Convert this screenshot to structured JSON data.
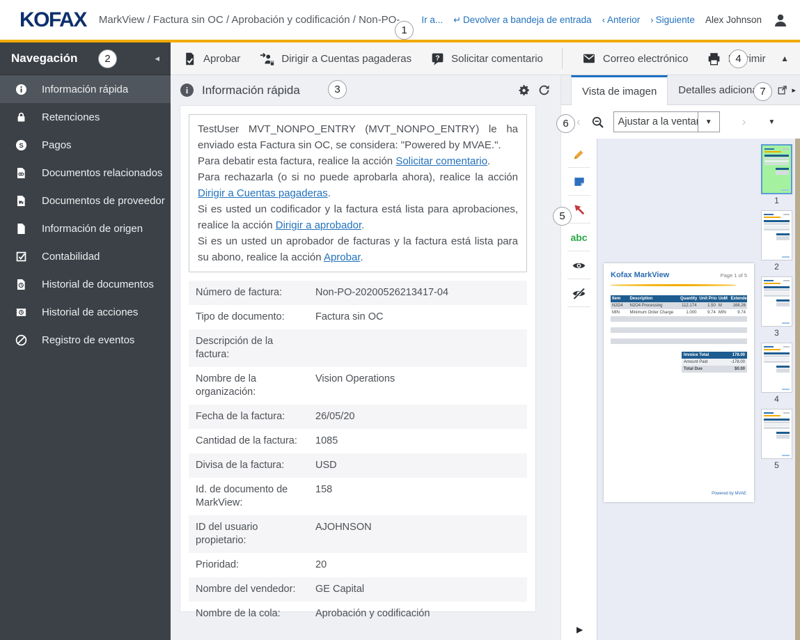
{
  "header": {
    "logo": "KOFAX",
    "breadcrumb": "MarkView / Factura sin OC / Aprobación y codificación / Non-PO-.",
    "go_to": "Ir a...",
    "return_link": "Devolver a bandeja de entrada",
    "prev": "Anterior",
    "next": "Siguiente",
    "user": "Alex Johnson"
  },
  "callouts": {
    "c1": "1",
    "c2": "2",
    "c3": "3",
    "c4": "4",
    "c5": "5",
    "c6": "6",
    "c7": "7"
  },
  "toolbar": {
    "approve": "Aprobar",
    "route_ap": "Dirigir a Cuentas pagaderas",
    "request_comment": "Solicitar comentario",
    "email": "Correo electrónico",
    "print": "Imprimir"
  },
  "sidebar": {
    "title": "Navegación",
    "items": [
      {
        "label": "Información rápida",
        "active": true
      },
      {
        "label": "Retenciones"
      },
      {
        "label": "Pagos"
      },
      {
        "label": "Documentos relacionados"
      },
      {
        "label": "Documentos de proveedor"
      },
      {
        "label": "Información de origen"
      },
      {
        "label": "Contabilidad"
      },
      {
        "label": "Historial de documentos"
      },
      {
        "label": "Historial de acciones"
      },
      {
        "label": "Registro de eventos"
      }
    ]
  },
  "quick_info": {
    "title": "Información rápida",
    "message": {
      "s1": "TestUser MVT_NONPO_ENTRY (MVT_NONPO_ENTRY) le ha enviado esta Factura sin OC, se considera: \"Powered by MVAE.\".",
      "s2_pre": "Para debatir esta factura, realice la acción ",
      "s2_link": "Solicitar comentario",
      "s2_post": ".",
      "s3_pre": "Para rechazarla (o si no puede aprobarla ahora), realice la acción ",
      "s3_link": "Dirigir a Cuentas pagaderas",
      "s3_post": ".",
      "s4_pre": "Si es usted un codificador y la factura está lista para aprobaciones, realice la acción ",
      "s4_link": "Dirigir a aprobador",
      "s4_post": ".",
      "s5_pre": "Si es un usted un aprobador de facturas y la factura está lista para su abono, realice la acción ",
      "s5_link": "Aprobar",
      "s5_post": "."
    },
    "fields": [
      {
        "label": "Número de factura:",
        "value": "Non-PO-20200526213417-04"
      },
      {
        "label": "Tipo de documento:",
        "value": "Factura sin OC"
      },
      {
        "label": "Descripción de la factura:",
        "value": ""
      },
      {
        "label": "Nombre de la organización:",
        "value": "Vision Operations"
      },
      {
        "label": "Fecha de la factura:",
        "value": "26/05/20"
      },
      {
        "label": "Cantidad de la factura:",
        "value": "1085"
      },
      {
        "label": "Divisa de la factura:",
        "value": "USD"
      },
      {
        "label": "Id. de documento de MarkView:",
        "value": "158"
      },
      {
        "label": "ID del usuario propietario:",
        "value": "AJOHNSON"
      },
      {
        "label": "Prioridad:",
        "value": "20"
      },
      {
        "label": "Nombre del vendedor:",
        "value": "GE Capital"
      },
      {
        "label": "Nombre de la cola:",
        "value": "Aprobación y codificación"
      }
    ]
  },
  "viewer": {
    "tab_image": "Vista de imagen",
    "tab_details": "Detalles adicionales",
    "zoom_value": "Ajustar a la ventana",
    "preview": {
      "title": "Kofax MarkView",
      "page_label": "Page 1 of 5",
      "headers": [
        "Item",
        "Description",
        "Quantity",
        "Unit Price",
        "UoM",
        "Extended"
      ],
      "rows": [
        [
          "N2O4",
          "N2O4 Processing",
          "112.174",
          "1.50",
          "M",
          "168.26"
        ],
        [
          "MIN",
          "Minimum Order Charge",
          "1.000",
          "9.74",
          "MIN",
          "9.74"
        ]
      ],
      "totals": [
        {
          "label": "Invoice Total",
          "value": "178.00"
        },
        {
          "label": "Amount Paid",
          "value": "-178.00"
        },
        {
          "label": "Total Due",
          "value": "$0.00"
        }
      ],
      "footer": "Powered by MVAE"
    },
    "thumbnails": [
      "1",
      "2",
      "3",
      "4",
      "5"
    ]
  }
}
